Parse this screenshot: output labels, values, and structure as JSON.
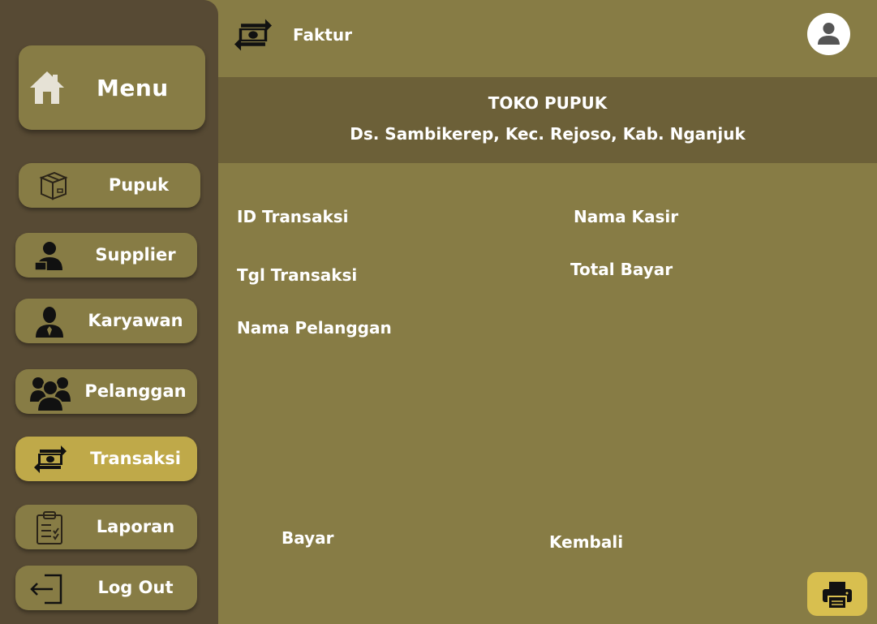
{
  "header": {
    "title": "Faktur"
  },
  "sidebar": {
    "menu_label": "Menu",
    "items": [
      {
        "label": "Pupuk"
      },
      {
        "label": "Supplier"
      },
      {
        "label": "Karyawan"
      },
      {
        "label": "Pelanggan"
      },
      {
        "label": "Transaksi",
        "active": true
      },
      {
        "label": "Laporan"
      },
      {
        "label": "Log Out"
      }
    ]
  },
  "store": {
    "name": "TOKO PUPUK",
    "address": "Ds. Sambikerep, Kec. Rejoso, Kab. Nganjuk"
  },
  "fields": {
    "id_transaksi": "ID Transaksi",
    "nama_kasir": "Nama Kasir",
    "tgl_transaksi": "Tgl Transaksi",
    "total_bayar": "Total Bayar",
    "nama_pelanggan": "Nama Pelanggan",
    "bayar": "Bayar",
    "kembali": "Kembali"
  },
  "colors": {
    "background": "#877c45",
    "sidebar": "#574a34",
    "band": "#6c6038",
    "active": "#bfa949",
    "print_button": "#d8bf4f"
  },
  "icons": {
    "menu": "home-icon",
    "pupuk": "box-icon",
    "supplier": "supplier-icon",
    "karyawan": "employee-icon",
    "pelanggan": "group-icon",
    "transaksi": "money-exchange-icon",
    "laporan": "clipboard-icon",
    "logout": "logout-icon",
    "user": "user-icon",
    "print": "printer-icon"
  }
}
